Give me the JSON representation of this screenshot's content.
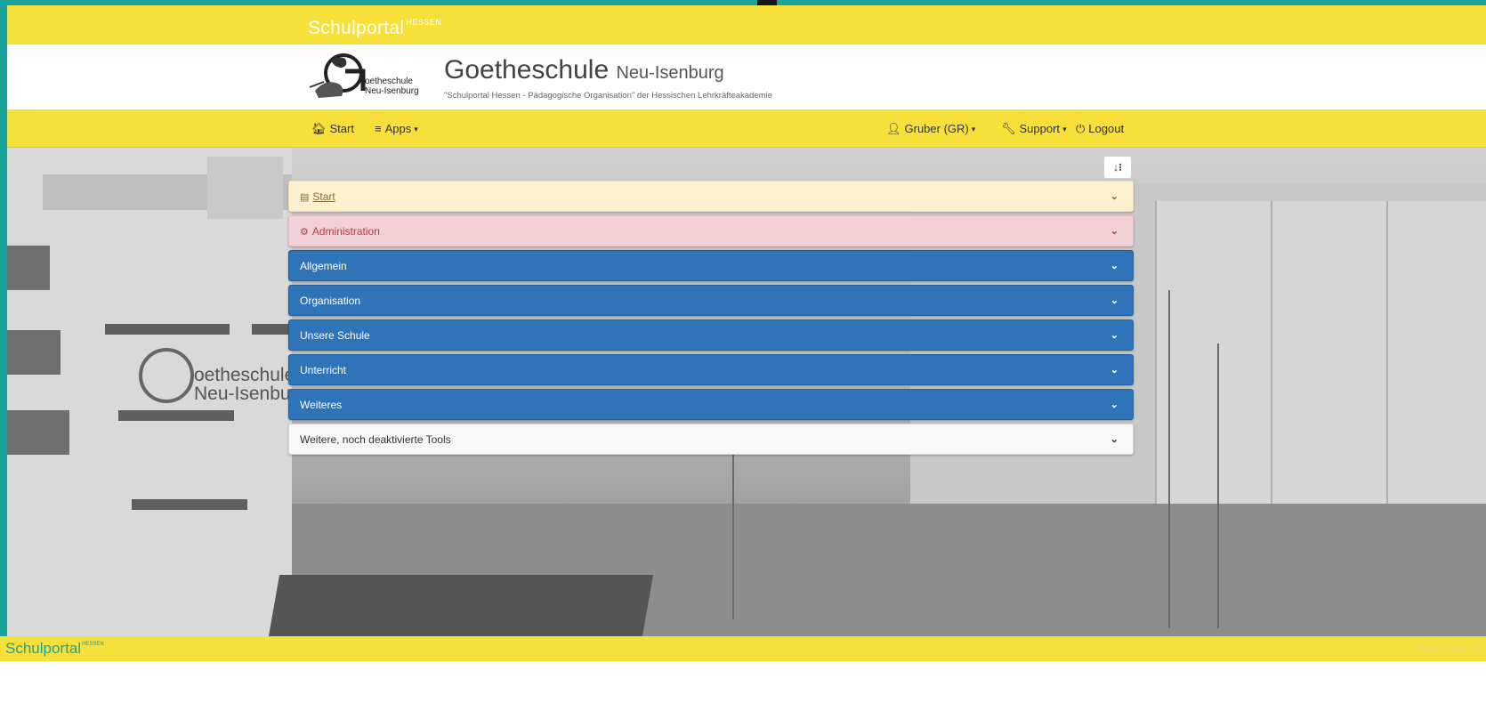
{
  "topbar": {
    "brand": "Schulportal",
    "brand_sup": "HESSEN"
  },
  "header": {
    "logo_text_line1": "oetheschule",
    "logo_text_line2": "Neu-Isenburg",
    "title": "Goetheschule",
    "title_suffix": "Neu-Isenburg",
    "subtitle": "\"Schulportal Hessen - Pädagogische Organisation\" der Hessischen Lehrkräfteakademie"
  },
  "nav": {
    "start": "Start",
    "apps": "Apps",
    "user": "Gruber (GR)",
    "support": "Support",
    "logout": "Logout"
  },
  "background": {
    "sign_line1": "oetheschule",
    "sign_line2": "Neu-Isenbur"
  },
  "sort_button_label": "↓⁝",
  "panels": [
    {
      "label": "Start",
      "style": "start"
    },
    {
      "label": "Administration",
      "style": "admin"
    },
    {
      "label": "Allgemein",
      "style": "blue"
    },
    {
      "label": "Organisation",
      "style": "blue"
    },
    {
      "label": "Unsere Schule",
      "style": "blue"
    },
    {
      "label": "Unterricht",
      "style": "blue"
    },
    {
      "label": "Weiteres",
      "style": "blue"
    },
    {
      "label": "Weitere, noch deaktivierte Tools",
      "style": "white"
    }
  ],
  "footer": {
    "brand": "Schulportal",
    "brand_sup": "HESSEN",
    "links": "Datenschutz | Impres"
  },
  "colors": {
    "yellow": "#f8e03a",
    "teal": "#1aa39a",
    "panel_blue": "#2f73b8",
    "panel_start": "#fcf0cf",
    "panel_admin": "#f2d1d6"
  },
  "icons": {
    "start": "home-icon",
    "apps": "list-icon",
    "user": "user-icon",
    "support": "wrench-icon",
    "logout": "power-icon",
    "panel_start": "newspaper-icon",
    "panel_admin": "cogs-icon",
    "chevron": "chevron-down-icon",
    "sort": "sort-icon"
  }
}
